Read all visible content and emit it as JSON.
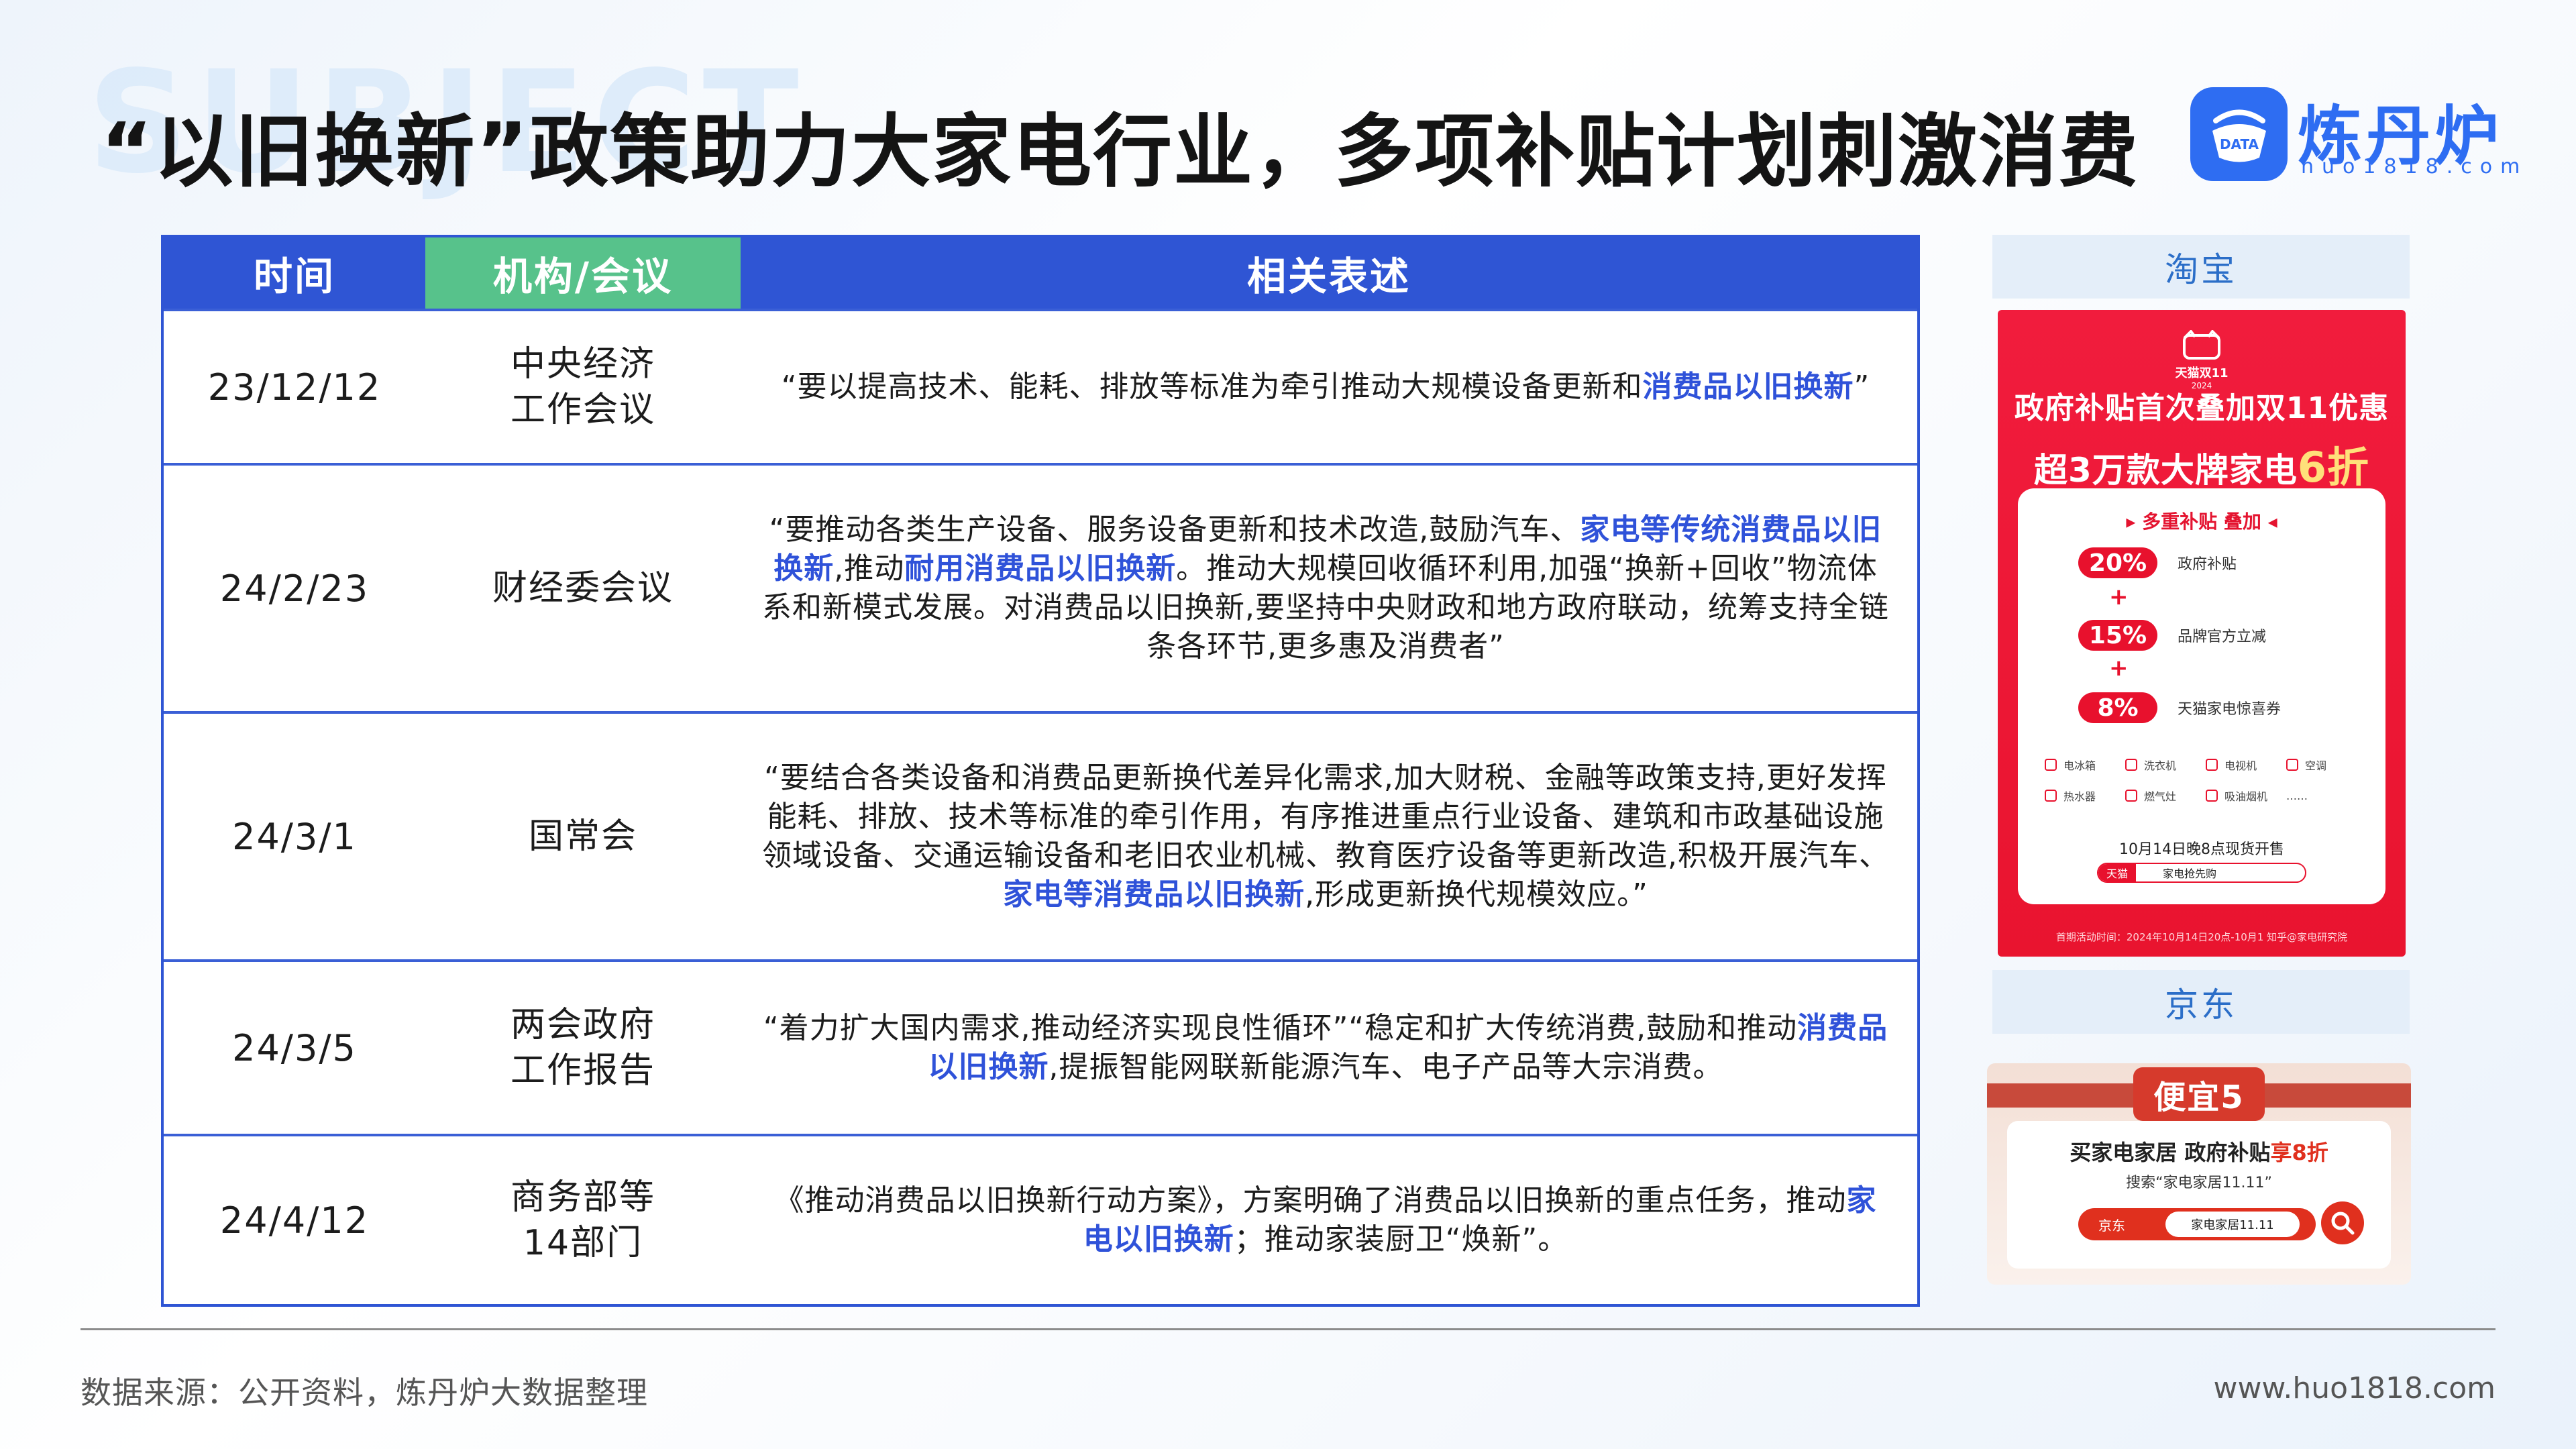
{
  "bg_word": "SUBJECT",
  "title": "“以旧换新”政策助力大家电行业，多项补贴计划刺激消费",
  "logo": {
    "name": "炼丹炉",
    "url": "huo1818.com",
    "mark": "DATA",
    "brand_color": "#2e6df2"
  },
  "table": {
    "headers": [
      "时间",
      "机构/会议",
      "相关表述"
    ],
    "header_colors": {
      "primary": "#2f55d4",
      "accent": "#57c28b"
    },
    "highlight_color": "#2f52d9",
    "rows": [
      {
        "date": "23/12/12",
        "org_lines": [
          "中央经济",
          "工作会议"
        ],
        "desc": [
          {
            "t": "“要以提高技术、能耗、排放等标准为牵引推动大规模设备更新和"
          },
          {
            "t": "消费品以旧换新",
            "hl": true
          },
          {
            "t": "”"
          }
        ]
      },
      {
        "date": "24/2/23",
        "org_lines": [
          "财经委会议"
        ],
        "desc": [
          {
            "t": "“要推动各类生产设备、服务设备更新和技术改造,鼓励汽车、"
          },
          {
            "t": "家电等传统消费品以旧换新",
            "hl": true
          },
          {
            "t": ",推动"
          },
          {
            "t": "耐用消费品以旧换新",
            "hl": true
          },
          {
            "t": "。推动大规模回收循环利用,加强“换新+回收”物流体系和新模式发展。对消费品以旧换新,要坚持中央财政和地方政府联动，统筹支持全链条各环节,更多惠及消费者”"
          }
        ]
      },
      {
        "date": "24/3/1",
        "org_lines": [
          "国常会"
        ],
        "desc": [
          {
            "t": "“要结合各类设备和消费品更新换代差异化需求,加大财税、金融等政策支持,更好发挥能耗、排放、技术等标准的牵引作用，有序推进重点行业设备、建筑和市政基础设施领域设备、交通运输设备和老旧农业机械、教育医疗设备等更新改造,积极开展汽车、"
          },
          {
            "t": "家电等消费品以旧换新",
            "hl": true
          },
          {
            "t": ",形成更新换代规模效应。”"
          }
        ]
      },
      {
        "date": "24/3/5",
        "org_lines": [
          "两会政府",
          "工作报告"
        ],
        "desc": [
          {
            "t": "“着力扩大国内需求,推动经济实现良性循环”“稳定和扩大传统消费,鼓励和推动"
          },
          {
            "t": "消费品以旧换新",
            "hl": true
          },
          {
            "t": ",提振智能网联新能源汽车、电子产品等大宗消费。"
          }
        ]
      },
      {
        "date": "24/4/12",
        "org_lines": [
          "商务部等",
          "14部门"
        ],
        "desc": [
          {
            "t": "《推动消费品以旧换新行动方案》，方案明确了消费品以旧换新的重点任务，推动"
          },
          {
            "t": "家电以旧换新",
            "hl": true
          },
          {
            "t": "；推动家装厨卫“焕新”。"
          }
        ]
      }
    ]
  },
  "taobao": {
    "label": "淘宝",
    "badge": "天猫双11",
    "badge_year": "2024",
    "headline_1": "政府补贴首次叠加双11优惠",
    "headline_2_pre": "超3万款大牌家电",
    "headline_2_big": "6折",
    "card_head": "多重补贴 叠加",
    "tiers": [
      {
        "pct": "20%",
        "desc": "政府补贴"
      },
      {
        "pct": "15%",
        "desc": "品牌官方立减"
      },
      {
        "pct": "8%",
        "desc": "天猫家电惊喜券"
      }
    ],
    "appliances": [
      "电冰箱",
      "洗衣机",
      "电视机",
      "空调",
      "热水器",
      "燃气灶",
      "吸油烟机",
      "……"
    ],
    "sale_time": "10月14日晚8点现货开售",
    "bar_brand": "天猫",
    "bar_text": "家电抢先购",
    "footer": "首期活动时间：2024年10月14日20点-10月1 知乎@家电研究院",
    "bg_color": "#f11c3d"
  },
  "jd": {
    "label": "京东",
    "tag": "便宜5",
    "headline_pre": "买家电家居 政府补贴",
    "headline_red": "享8折",
    "sub": "搜索“家电家居11.11”",
    "brand": "京东",
    "search_text": "家电家居11.11",
    "accent_color": "#e0301e"
  },
  "footer": {
    "source": "数据来源：公开资料，炼丹炉大数据整理",
    "site": "www.huo1818.com"
  }
}
